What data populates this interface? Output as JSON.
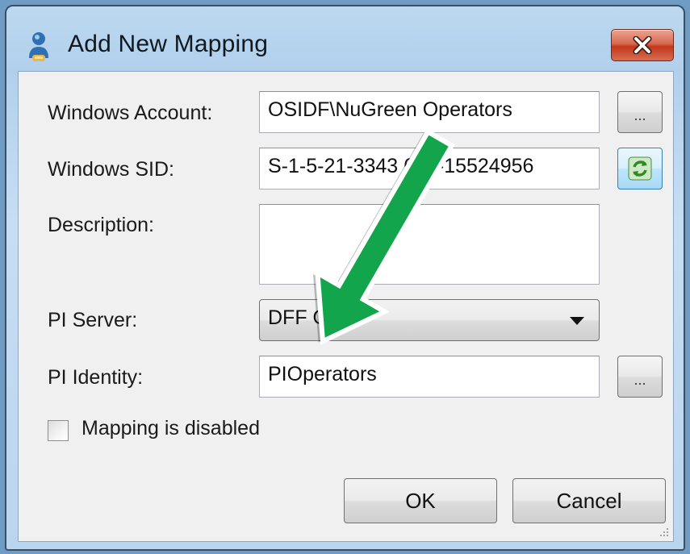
{
  "window": {
    "title": "Add New Mapping",
    "close_label": "X"
  },
  "form": {
    "windows_account": {
      "label": "Windows Account:",
      "value": "OSIDF\\NuGreen Operators",
      "browse_label": "..."
    },
    "windows_sid": {
      "label": "Windows SID:",
      "value": "S-1-5-21-3343  656-15524956"
    },
    "description": {
      "label": "Description:",
      "value": ""
    },
    "pi_server": {
      "label": "PI Server:",
      "selected": "DFF   ORC"
    },
    "pi_identity": {
      "label": "PI Identity:",
      "value": "PIOperators",
      "browse_label": "..."
    },
    "mapping_disabled": {
      "label": "Mapping is disabled",
      "checked": false
    }
  },
  "buttons": {
    "ok_label": "OK",
    "cancel_label": "Cancel"
  },
  "annotation": {
    "arrow_color": "#13a54b",
    "arrow_outline": "#ffffff"
  }
}
